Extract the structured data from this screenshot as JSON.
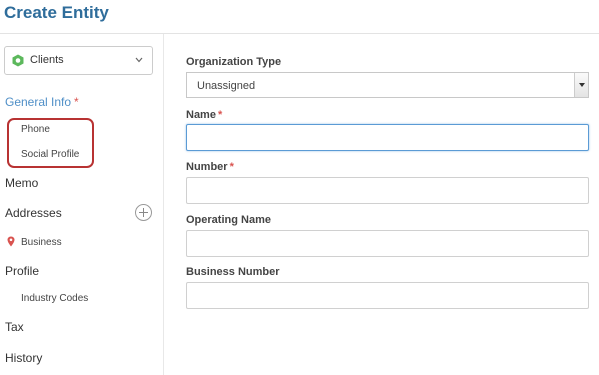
{
  "page": {
    "title": "Create Entity"
  },
  "sidebar": {
    "entity_type": {
      "label": "Clients"
    },
    "nav": {
      "general_info": {
        "label": "General Info",
        "required": "*"
      },
      "phone": "Phone",
      "social_profile": "Social Profile",
      "memo": "Memo",
      "addresses": "Addresses",
      "business_address": "Business",
      "profile": "Profile",
      "industry_codes": "Industry Codes",
      "tax": "Tax",
      "history": "History"
    }
  },
  "form": {
    "organization_type": {
      "label": "Organization Type",
      "value": "Unassigned"
    },
    "name": {
      "label": "Name",
      "required": "*",
      "value": ""
    },
    "number": {
      "label": "Number",
      "required": "*",
      "value": ""
    },
    "operating_name": {
      "label": "Operating Name",
      "value": ""
    },
    "business_number": {
      "label": "Business Number",
      "value": ""
    }
  },
  "colors": {
    "accent": "#2f6d9b",
    "active_nav": "#4f8fc7",
    "required": "#d9534f",
    "highlight": "#b83232",
    "clients_icon": "#5cb85c",
    "pin": "#d9534f"
  }
}
